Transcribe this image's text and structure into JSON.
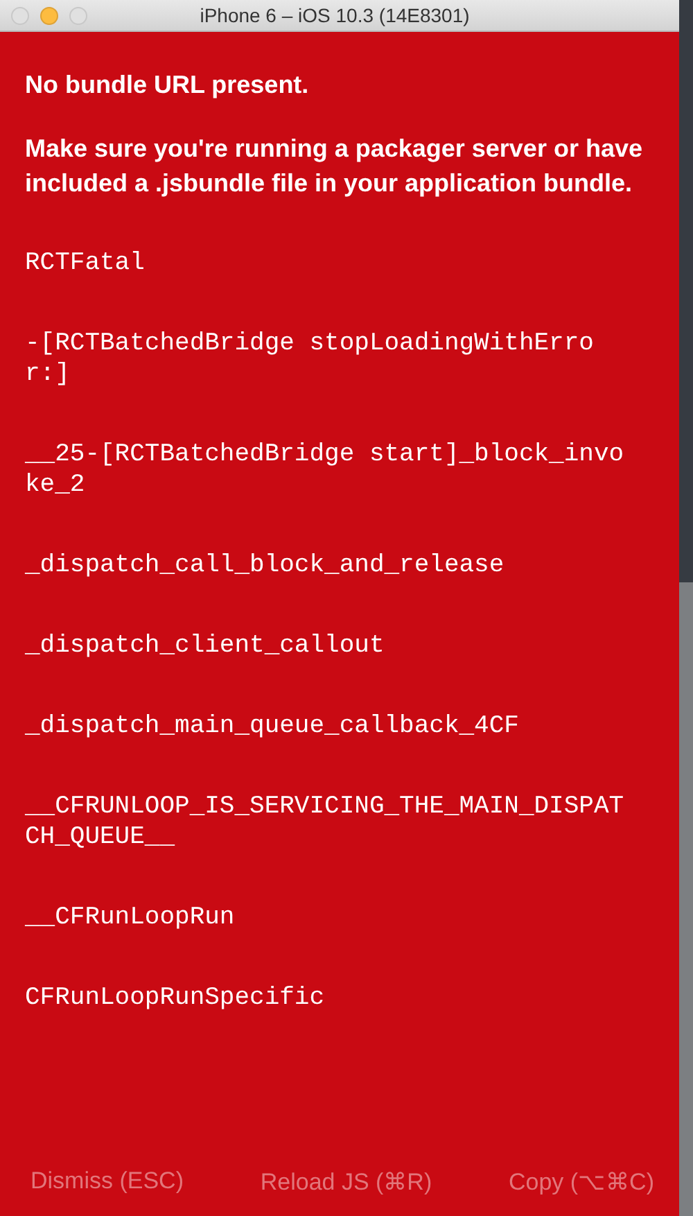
{
  "window": {
    "title": "iPhone 6 – iOS 10.3 (14E8301)"
  },
  "error": {
    "title": "No bundle URL present.",
    "message": "Make sure you're running a packager server or have included a .jsbundle file in your application bundle.",
    "stack": [
      "RCTFatal",
      "-[RCTBatchedBridge stopLoadingWithError:]",
      "__25-[RCTBatchedBridge start]_block_invoke_2",
      "_dispatch_call_block_and_release",
      "_dispatch_client_callout",
      "_dispatch_main_queue_callback_4CF",
      "__CFRUNLOOP_IS_SERVICING_THE_MAIN_DISPATCH_QUEUE__",
      "__CFRunLoopRun",
      "CFRunLoopRunSpecific"
    ]
  },
  "buttons": [
    "Dismiss (ESC)",
    "Reload JS (⌘R)",
    "Copy (⌥⌘C)"
  ]
}
